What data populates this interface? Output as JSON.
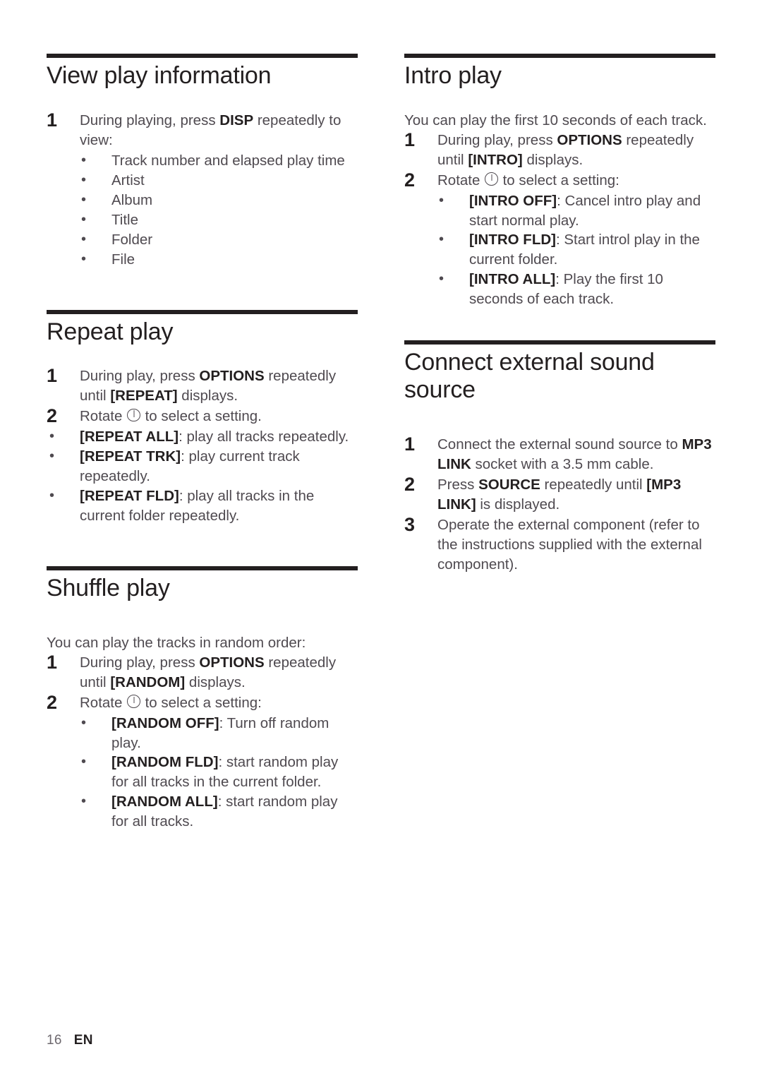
{
  "page": {
    "number": "16",
    "language": "EN"
  },
  "icons": {
    "knob": "standby-rotate-knob-icon"
  },
  "left_column": {
    "sections": [
      {
        "id": "view-play-information",
        "heading": "View play information",
        "steps": [
          {
            "num": "1",
            "text_before": "During playing, press ",
            "bold": "DISP",
            "text_after": " repeatedly to view:"
          }
        ],
        "bullets": [
          {
            "text": "Track number and elapsed play time"
          },
          {
            "text": "Artist"
          },
          {
            "text": "Album"
          },
          {
            "text": "Title"
          },
          {
            "text": "Folder"
          },
          {
            "text": "File"
          }
        ]
      },
      {
        "id": "repeat-play",
        "heading": "Repeat play",
        "step1": {
          "num": "1",
          "a": "During play, press ",
          "b1": "OPTIONS",
          "c": " repeatedly until ",
          "b2": "[REPEAT]",
          "d": " displays."
        },
        "step2": {
          "num": "2",
          "a": "Rotate ",
          "b": " to select a setting."
        },
        "bullets": [
          {
            "label": "[REPEAT ALL]",
            "text": ": play all tracks repeatedly."
          },
          {
            "label": "[REPEAT TRK]",
            "text": ": play current track repeatedly."
          },
          {
            "label": "[REPEAT FLD]",
            "text": ": play all tracks in the current folder repeatedly."
          }
        ]
      },
      {
        "id": "shuffle-play",
        "heading": "Shuffle play",
        "lead": "You can play the tracks in random order:",
        "step1": {
          "num": "1",
          "a": "During play, press ",
          "b1": "OPTIONS",
          "c": " repeatedly until ",
          "b2": "[RANDOM]",
          "d": " displays."
        },
        "step2": {
          "num": "2",
          "a": "Rotate ",
          "b": " to select a setting:"
        },
        "bullets": [
          {
            "label": "[RANDOM OFF]",
            "text": ": Turn off random play."
          },
          {
            "label": "[RANDOM FLD]",
            "text": ": start random play for all tracks in the current folder."
          },
          {
            "label": "[RANDOM ALL]",
            "text": ": start random play for all tracks."
          }
        ]
      }
    ]
  },
  "right_column": {
    "sections": [
      {
        "id": "intro-play",
        "heading": "Intro play",
        "lead": "You can play the first 10 seconds of each track.",
        "step1": {
          "num": "1",
          "a": "During play, press ",
          "b1": "OPTIONS",
          "c": " repeatedly until ",
          "b2": "[INTRO]",
          "d": " displays."
        },
        "step2": {
          "num": "2",
          "a": "Rotate ",
          "b": " to select a setting:"
        },
        "bullets": [
          {
            "label": "[INTRO OFF]",
            "text": ": Cancel intro play and start normal play."
          },
          {
            "label": "[INTRO FLD]",
            "text": ": Start introl play in the current folder."
          },
          {
            "label": "[INTRO ALL]",
            "text": ": Play the first 10 seconds of each track."
          }
        ]
      },
      {
        "id": "connect-external-sound-source",
        "heading": "Connect external sound source",
        "steps": [
          {
            "num": "1",
            "a": "Connect the external sound source to ",
            "b": "MP3 LINK",
            "c": " socket with a 3.5 mm cable."
          },
          {
            "num": "2",
            "a": "Press ",
            "b": "SOURCE",
            "c": " repeatedly until ",
            "b2": "[MP3 LINK]",
            "d": " is displayed."
          },
          {
            "num": "3",
            "a": "Operate the external component (refer to the instructions supplied with the external component)."
          }
        ]
      }
    ]
  }
}
